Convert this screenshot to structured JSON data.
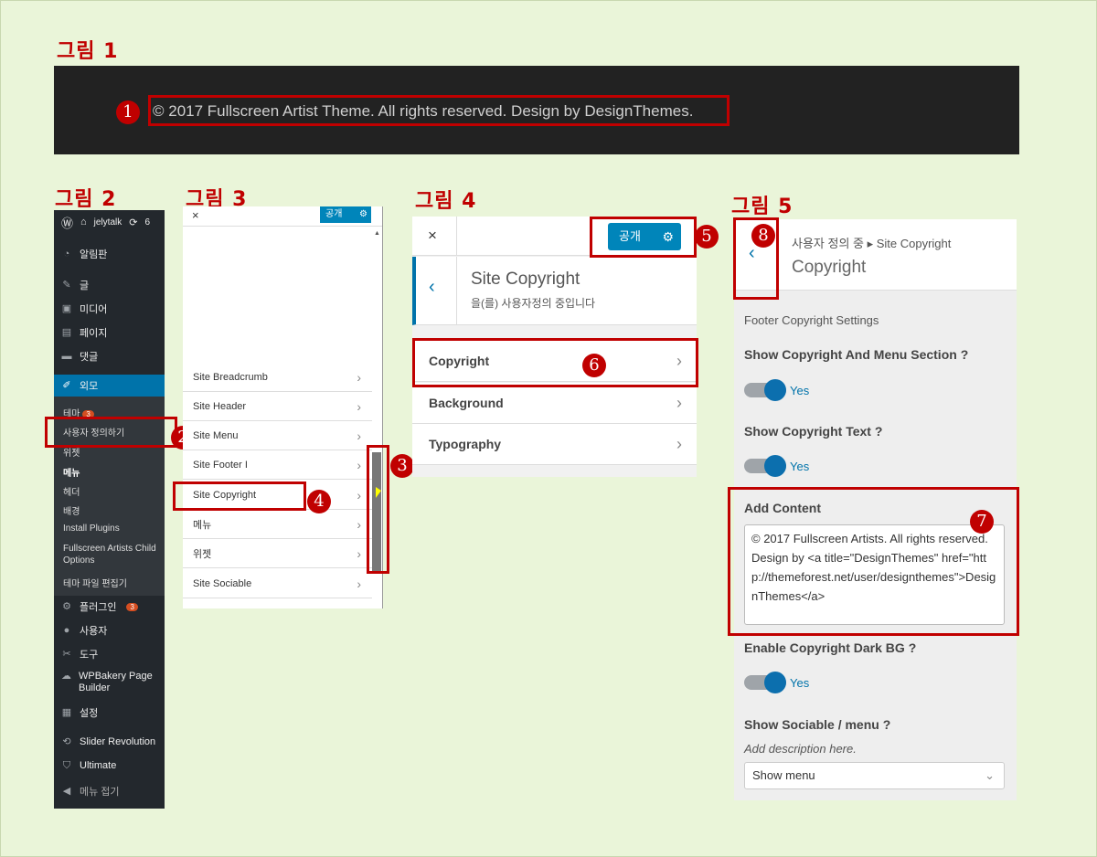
{
  "fig_labels": [
    "그림 1",
    "그림 2",
    "그림 3",
    "그림 4",
    "그림 5"
  ],
  "badges": [
    "1",
    "2",
    "3",
    "4",
    "5",
    "6",
    "7",
    "8"
  ],
  "accent": "#c00000",
  "wp_blue": "#0085ba",
  "fig1": {
    "copyright": "© 2017 Fullscreen Artist Theme. All rights reserved. Design by DesignThemes."
  },
  "fig2": {
    "site_name": "jelytalk",
    "updates_count": "6",
    "menu": {
      "dashboard": "알림판",
      "posts": "글",
      "media": "미디어",
      "pages": "페이지",
      "comments": "댓글",
      "appearance": "외모",
      "plugins": "플러그인",
      "users": "사용자",
      "tools": "도구",
      "wpbakery": "WPBakery Page Builder",
      "settings": "설정",
      "slider": "Slider Revolution",
      "ultimate": "Ultimate",
      "collapse": "메뉴 접기"
    },
    "plugins_count": "3",
    "submenu": {
      "themes": "테마",
      "themes_count": "3",
      "customize": "사용자 정의하기",
      "widgets": "위젯",
      "menus": "메뉴",
      "header": "헤더",
      "background": "배경",
      "install_plugins": "Install Plugins",
      "child_options": "Fullscreen Artists Child Options",
      "editor": "테마 파일 편집기"
    }
  },
  "fig3": {
    "close": "×",
    "publish": "공개",
    "items": [
      "Site Breadcrumb",
      "Site Header",
      "Site Menu",
      "Site Footer I",
      "Site Copyright",
      "메뉴",
      "위젯",
      "Site Sociable"
    ]
  },
  "fig4": {
    "close": "×",
    "publish": "공개",
    "section_title": "Site Copyright",
    "section_sub": "을(를) 사용자정의 중입니다",
    "items": [
      "Copyright",
      "Background",
      "Typography"
    ]
  },
  "fig5": {
    "breadcrumb": "사용자 정의 중 ▸ Site Copyright",
    "title": "Copyright",
    "group_label": "Footer Copyright Settings",
    "show_section_label": "Show Copyright And Menu Section ?",
    "yes": "Yes",
    "show_text_label": "Show Copyright Text ?",
    "add_content_label": "Add Content",
    "add_content_value": "© 2017 Fullscreen Artists. All rights reserved. Design by <a title=\"DesignThemes\" href=\"http://themeforest.net/user/designthemes\">DesignThemes</a>",
    "dark_bg_label": "Enable Copyright Dark BG ?",
    "sociable_label": "Show Sociable / menu ?",
    "sociable_desc": "Add description here.",
    "sociable_value": "Show menu"
  }
}
